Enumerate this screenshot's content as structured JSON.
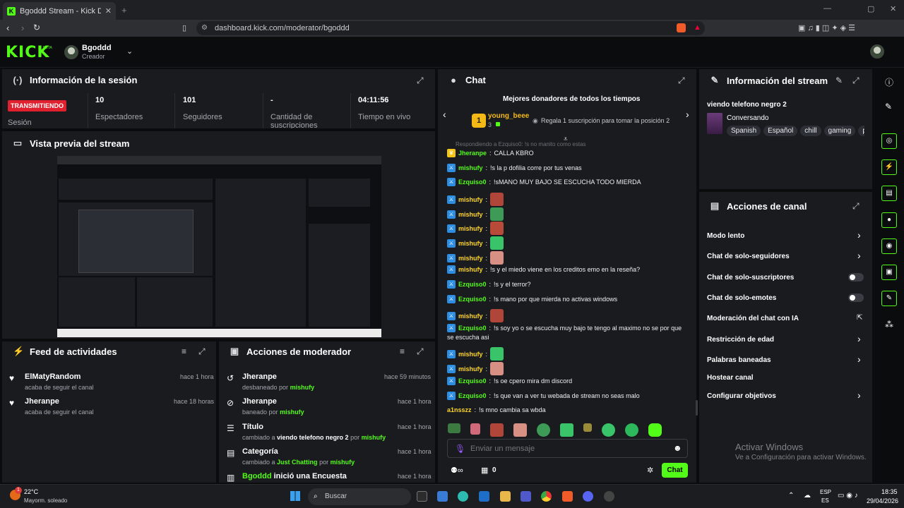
{
  "browser": {
    "tab_title": "Bgoddd Stream - Kick Dashboard",
    "url": "dashboard.kick.com/moderator/bgoddd"
  },
  "header": {
    "logo": "KICK",
    "beta": "BETA",
    "user_name": "Bgoddd",
    "user_role": "Creador"
  },
  "session": {
    "title": "Información de la sesión",
    "live_label": "TRANSMITIENDO",
    "session_label": "Sesión",
    "stats": [
      {
        "value": "10",
        "label": "Espectadores"
      },
      {
        "value": "101",
        "label": "Seguidores"
      },
      {
        "value": "-",
        "label": "Cantidad de suscripciones"
      },
      {
        "value": "04:11:56",
        "label": "Tiempo en vivo"
      }
    ]
  },
  "preview": {
    "title": "Vista previa del stream"
  },
  "activity": {
    "title": "Feed de actividades",
    "items": [
      {
        "name": "ElMatyRandom",
        "sub": "acaba de seguir el canal",
        "time": "hace 1 hora"
      },
      {
        "name": "Jheranpe",
        "sub": "acaba de seguir el canal",
        "time": "hace 18 horas"
      }
    ]
  },
  "modactions": {
    "title": "Acciones de moderador",
    "items": [
      {
        "name": "Jheranpe",
        "sub": "desbaneado por",
        "by": "mishufy",
        "time": "hace 59 minutos"
      },
      {
        "name": "Jheranpe",
        "sub": "baneado por",
        "by": "mishufy",
        "time": "hace 1 hora"
      },
      {
        "name": "Título",
        "sub": "cambiado a",
        "value": "viendo telefono negro 2",
        "by_pre": "por",
        "by": "mishufy",
        "time": "hace 1 hora"
      },
      {
        "name": "Categoría",
        "sub": "cambiado a",
        "value": "Just Chatting",
        "by_pre": "por",
        "by": "mishufy",
        "time": "hace 1 hora"
      },
      {
        "actor": "Bgoddd",
        "name": "inició una Encuesta",
        "time": "hace 1 hora"
      }
    ]
  },
  "chat": {
    "title": "Chat",
    "top_title": "Mejores donadores de todos los tiempos",
    "top_user": "young_beee",
    "top_rank": "1",
    "top_count": "3",
    "top_promo": "Regala 1 suscripción para tomar la posición 2",
    "reply_hint": "Respondiendo a Ezquiso0: !s no manito como estas",
    "messages": [
      {
        "user": "Jheranpe",
        "text": "CALLA KBRO",
        "badge": "mod",
        "color": "#53fc18"
      },
      {
        "user": "mishufy",
        "text": "!s la p dofilia corre por tus venas",
        "badge": "blue",
        "color": "#53fc18"
      },
      {
        "user": "Ezquiso0",
        "text": "!sMANO MUY BAJO SE ESCUCHA TODO MIERDA",
        "badge": "blue",
        "color": "#53fc18"
      },
      {
        "user": "mishufy",
        "text": "",
        "emote": "#b0463a",
        "badge": "blue",
        "color": "#ffd52a"
      },
      {
        "user": "mishufy",
        "text": "",
        "emote": "#3d9a57",
        "badge": "blue",
        "color": "#ffd52a"
      },
      {
        "user": "mishufy",
        "text": "",
        "emote": "#b84a3a",
        "badge": "blue",
        "color": "#ffd52a"
      },
      {
        "user": "mishufy",
        "text": "",
        "emote": "#3ac46a",
        "badge": "blue",
        "color": "#ffd52a"
      },
      {
        "user": "mishufy",
        "text": "",
        "emote": "#d88f84",
        "badge": "blue",
        "color": "#ffd52a"
      },
      {
        "user": "mishufy",
        "text": "!s y el miedo viene en los creditos emo en la reseña?",
        "badge": "blue",
        "color": "#ffd52a"
      },
      {
        "user": "Ezquiso0",
        "text": "!s y el terror?",
        "badge": "blue",
        "color": "#53fc18"
      },
      {
        "user": "Ezquiso0",
        "text": "!s mano por que mierda no activas windows",
        "badge": "blue",
        "color": "#53fc18"
      },
      {
        "user": "mishufy",
        "text": "",
        "emote": "#b0463a",
        "badge": "blue",
        "color": "#ffd52a"
      },
      {
        "user": "Ezquiso0",
        "text": "!s soy yo o se escucha muy bajo te tengo al maximo no se por que",
        "text2": "se escucha asi",
        "badge": "blue",
        "color": "#53fc18"
      },
      {
        "user": "mishufy",
        "text": "",
        "emote": "#3ac46a",
        "badge": "blue",
        "color": "#ffd52a"
      },
      {
        "user": "mishufy",
        "text": "",
        "emote": "#d88f84",
        "badge": "blue",
        "color": "#ffd52a"
      },
      {
        "user": "Ezquiso0",
        "text": "!s oe cpero mira dm discord",
        "badge": "blue",
        "color": "#53fc18"
      },
      {
        "user": "Ezquiso0",
        "text": "!s que van a ver tu webada de stream no seas malo",
        "badge": "blue",
        "color": "#53fc18"
      },
      {
        "user": "a1nsszz",
        "text": "!s mno cambia sa wbda",
        "badge": "none",
        "color": "#ffd52a"
      }
    ],
    "input_placeholder": "Enviar un mensaje",
    "bottom_count": "0",
    "send_label": "Chat"
  },
  "stream_info": {
    "title": "Información del stream",
    "stream_title": "viendo telefono negro 2",
    "category": "Conversando",
    "tags": [
      "Spanish",
      "Español",
      "chill",
      "gaming",
      "p"
    ]
  },
  "channel_actions": {
    "title": "Acciones de canal",
    "items": [
      {
        "label": "Modo lento",
        "control": "chevron"
      },
      {
        "label": "Chat de solo-seguidores",
        "control": "chevron"
      },
      {
        "label": "Chat de solo-suscriptores",
        "control": "toggle"
      },
      {
        "label": "Chat de solo-emotes",
        "control": "toggle"
      },
      {
        "label": "Moderación del chat con IA",
        "control": "external"
      },
      {
        "label": "Restricción de edad",
        "control": "chevron"
      },
      {
        "label": "Palabras baneadas",
        "control": "chevron"
      },
      {
        "label": "Hostear canal",
        "control": "none"
      },
      {
        "label": "Configurar objetivos",
        "control": "chevron"
      }
    ]
  },
  "watermark": {
    "line1": "Activar Windows",
    "line2": "Ve a Configuración para activar Windows."
  },
  "taskbar": {
    "temp": "22°C",
    "weather": "Mayorm. soleado",
    "search": "Buscar",
    "lang1": "ESP",
    "lang2": "ES",
    "time": "18:35",
    "date": "29/04/2026",
    "notif": "1"
  }
}
